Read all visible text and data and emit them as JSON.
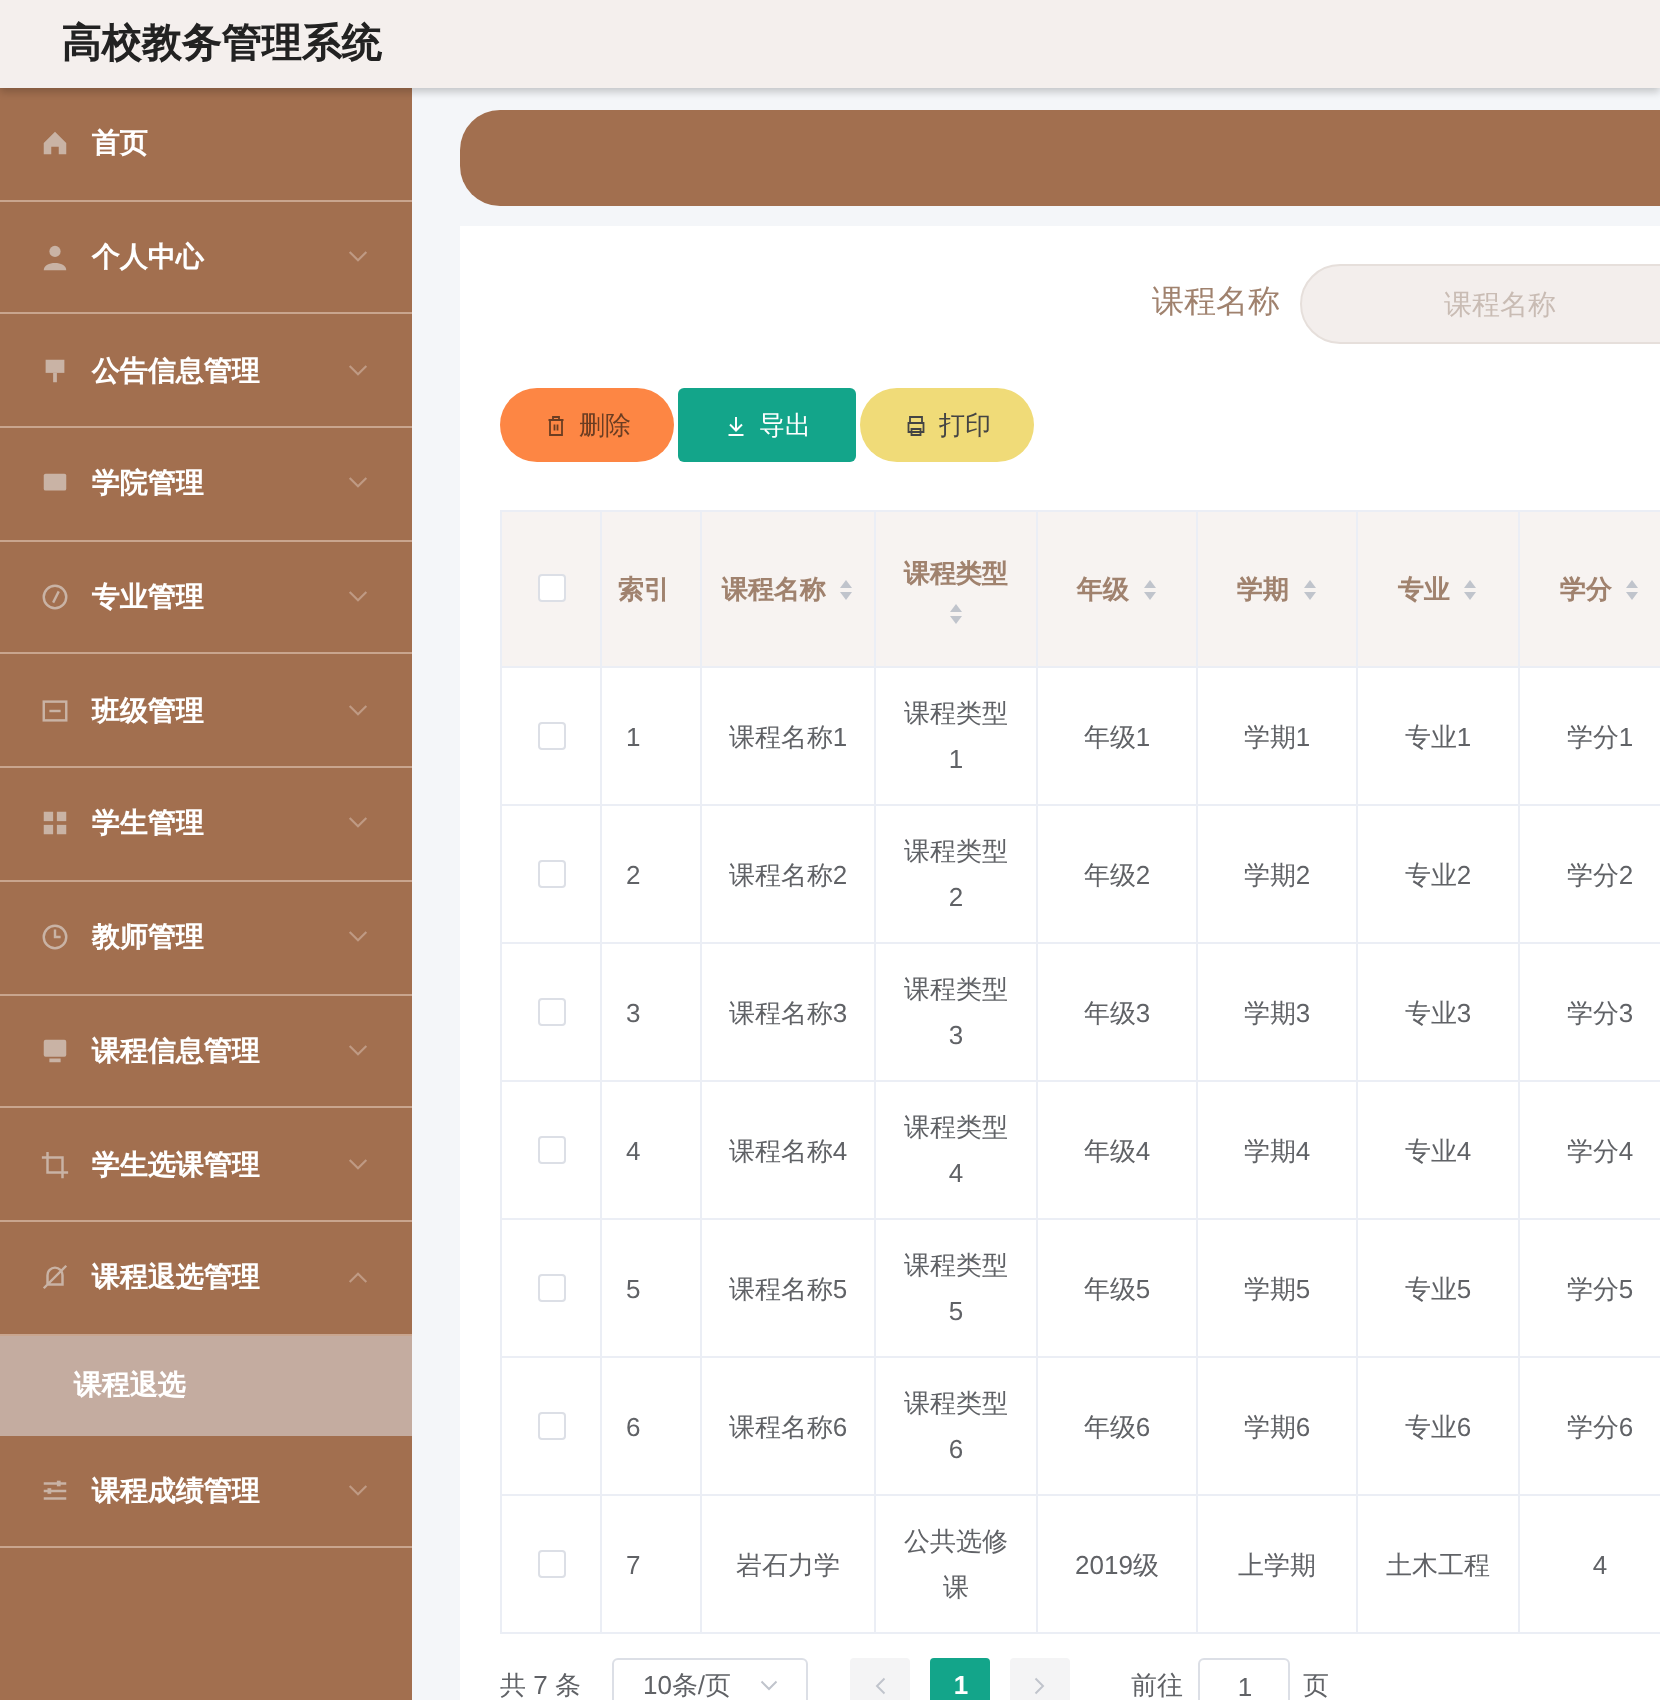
{
  "app_title": "高校教务管理系统",
  "sidebar": {
    "items": [
      {
        "label": "首页"
      },
      {
        "label": "个人中心",
        "expanded": false
      },
      {
        "label": "公告信息管理",
        "expanded": false
      },
      {
        "label": "学院管理",
        "expanded": false
      },
      {
        "label": "专业管理",
        "expanded": false
      },
      {
        "label": "班级管理",
        "expanded": false
      },
      {
        "label": "学生管理",
        "expanded": false
      },
      {
        "label": "教师管理",
        "expanded": false
      },
      {
        "label": "课程信息管理",
        "expanded": false
      },
      {
        "label": "学生选课管理",
        "expanded": false
      },
      {
        "label": "课程退选管理",
        "expanded": true,
        "children": [
          {
            "label": "课程退选",
            "selected": true
          }
        ]
      },
      {
        "label": "课程成绩管理",
        "expanded": false
      }
    ]
  },
  "search": {
    "label": "课程名称",
    "placeholder": "课程名称"
  },
  "actions": [
    {
      "kind": "delete",
      "label": "删除"
    },
    {
      "kind": "export",
      "label": "导出"
    },
    {
      "kind": "print",
      "label": "打印"
    }
  ],
  "table": {
    "header_checked": false,
    "columns": [
      {
        "label": "索引",
        "sortable": false
      },
      {
        "label": "课程名称",
        "sortable": true
      },
      {
        "label": "课程类型",
        "sortable": true
      },
      {
        "label": "年级",
        "sortable": true
      },
      {
        "label": "学期",
        "sortable": true
      },
      {
        "label": "专业",
        "sortable": true
      },
      {
        "label": "学分",
        "sortable": true
      }
    ],
    "rows": [
      {
        "checked": false,
        "cells": [
          "1",
          "课程名称1",
          "课程类型1",
          "年级1",
          "学期1",
          "专业1",
          "学分1"
        ]
      },
      {
        "checked": false,
        "cells": [
          "2",
          "课程名称2",
          "课程类型2",
          "年级2",
          "学期2",
          "专业2",
          "学分2"
        ]
      },
      {
        "checked": false,
        "cells": [
          "3",
          "课程名称3",
          "课程类型3",
          "年级3",
          "学期3",
          "专业3",
          "学分3"
        ]
      },
      {
        "checked": false,
        "cells": [
          "4",
          "课程名称4",
          "课程类型4",
          "年级4",
          "学期4",
          "专业4",
          "学分4"
        ]
      },
      {
        "checked": false,
        "cells": [
          "5",
          "课程名称5",
          "课程类型5",
          "年级5",
          "学期5",
          "专业5",
          "学分5"
        ]
      },
      {
        "checked": false,
        "cells": [
          "6",
          "课程名称6",
          "课程类型6",
          "年级6",
          "学期6",
          "专业6",
          "学分6"
        ]
      },
      {
        "checked": false,
        "cells": [
          "7",
          "岩石力学",
          "公共选修课",
          "2019级",
          "上学期",
          "土木工程",
          "4"
        ]
      }
    ]
  },
  "pagination": {
    "total": "共 7 条",
    "page_size": "10条/页",
    "pages": [
      {
        "label": "1",
        "selected": true
      }
    ],
    "goto_label": "前往",
    "goto_value": "1",
    "page_suffix": "页"
  }
}
